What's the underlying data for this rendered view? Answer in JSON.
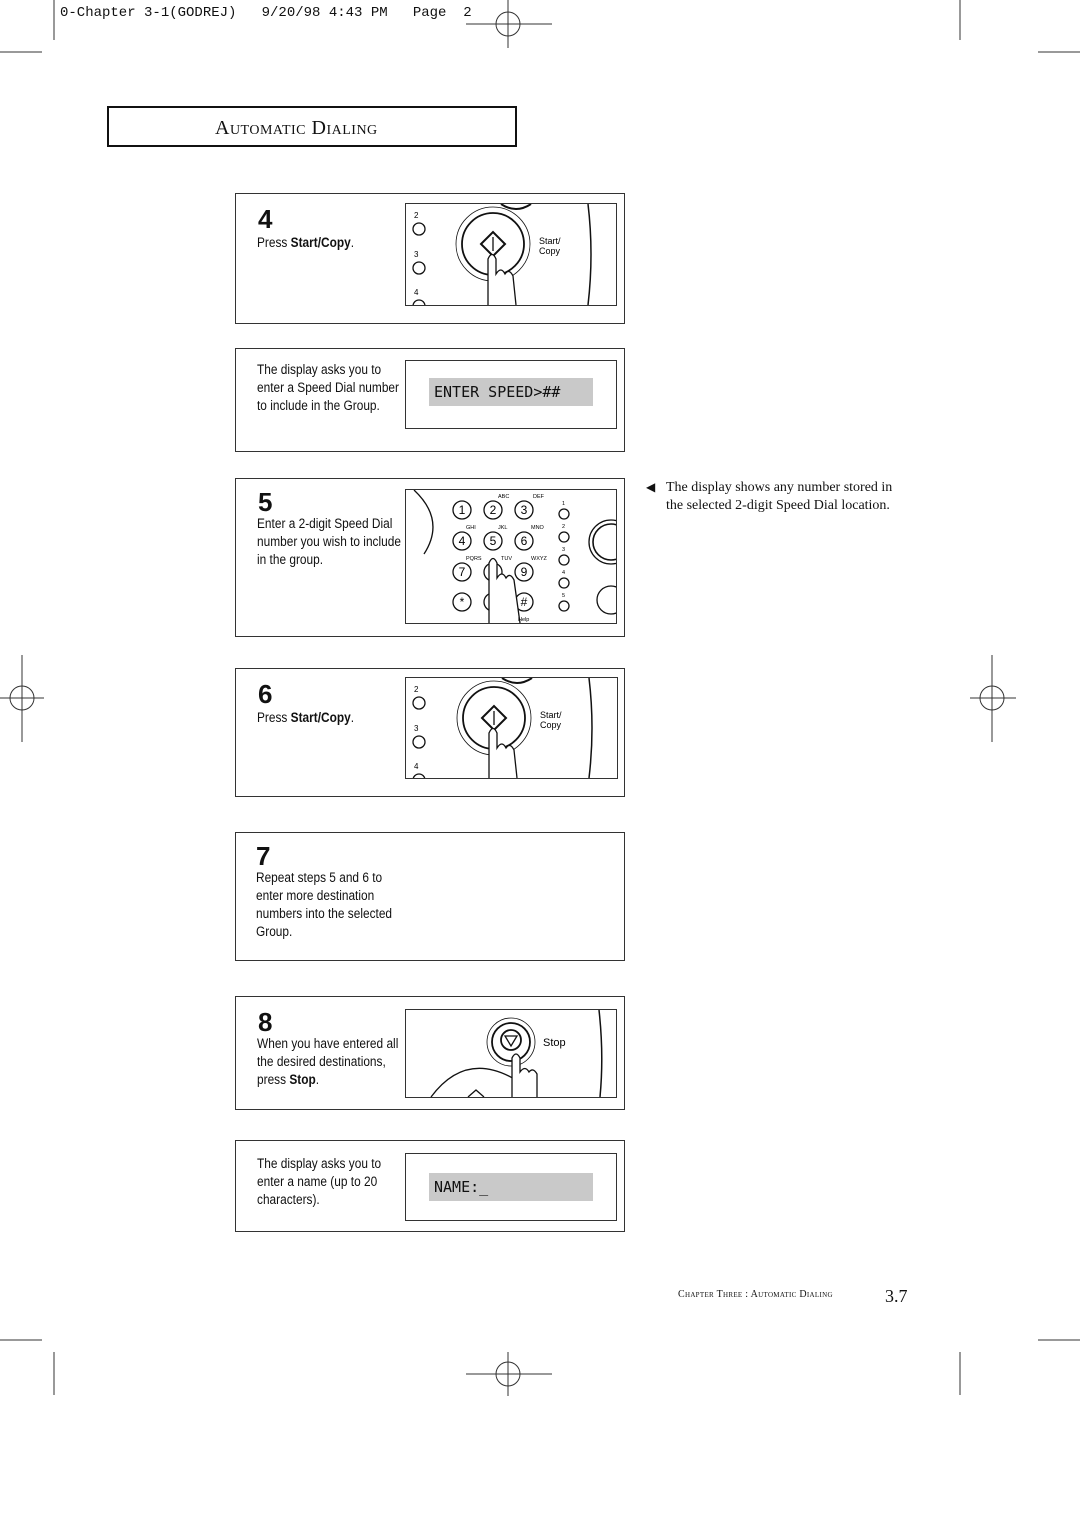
{
  "slug": "0-Chapter 3-1(GODREJ)   9/20/98 4:43 PM   Page  2",
  "section_title": "Automatic Dialing",
  "steps": [
    {
      "number": "4",
      "text_pre": "Press ",
      "text_bold": "Start/Copy",
      "text_post": "."
    },
    {
      "number": "",
      "text": "The display asks you to enter a Speed Dial number to include in the Group.",
      "lcd": "ENTER SPEED>##"
    },
    {
      "number": "5",
      "text": "Enter a 2-digit Speed Dial number you wish to include in the group."
    },
    {
      "number": "6",
      "text_pre": "Press ",
      "text_bold": "Start/Copy",
      "text_post": "."
    },
    {
      "number": "7",
      "text": "Repeat steps 5 and 6 to enter more destination numbers into the selected Group."
    },
    {
      "number": "8",
      "text_pre": "When you have entered all the desired destinations, press ",
      "text_bold": "Stop",
      "text_post": "."
    },
    {
      "number": "",
      "text": "The display asks you to enter a name (up to 20 characters).",
      "lcd": "NAME:_"
    }
  ],
  "illustration_labels": {
    "start_copy": [
      "Start/",
      "Copy"
    ],
    "stop": "Stop",
    "help": "Help",
    "one_touch": [
      "1",
      "2",
      "3",
      "4",
      "5"
    ],
    "keys": [
      "1",
      "2",
      "3",
      "4",
      "5",
      "6",
      "7",
      "8",
      "9",
      "*",
      "0",
      "#"
    ],
    "letters": [
      "ABC",
      "DEF",
      "GHI",
      "JKL",
      "MNO",
      "PQRS",
      "TUV",
      "WXYZ"
    ]
  },
  "side_note": "The display shows any number stored in the selected 2-digit Speed Dial location.",
  "footer": {
    "text": "Chapter Three : Automatic Dialing",
    "page": "3.7"
  }
}
